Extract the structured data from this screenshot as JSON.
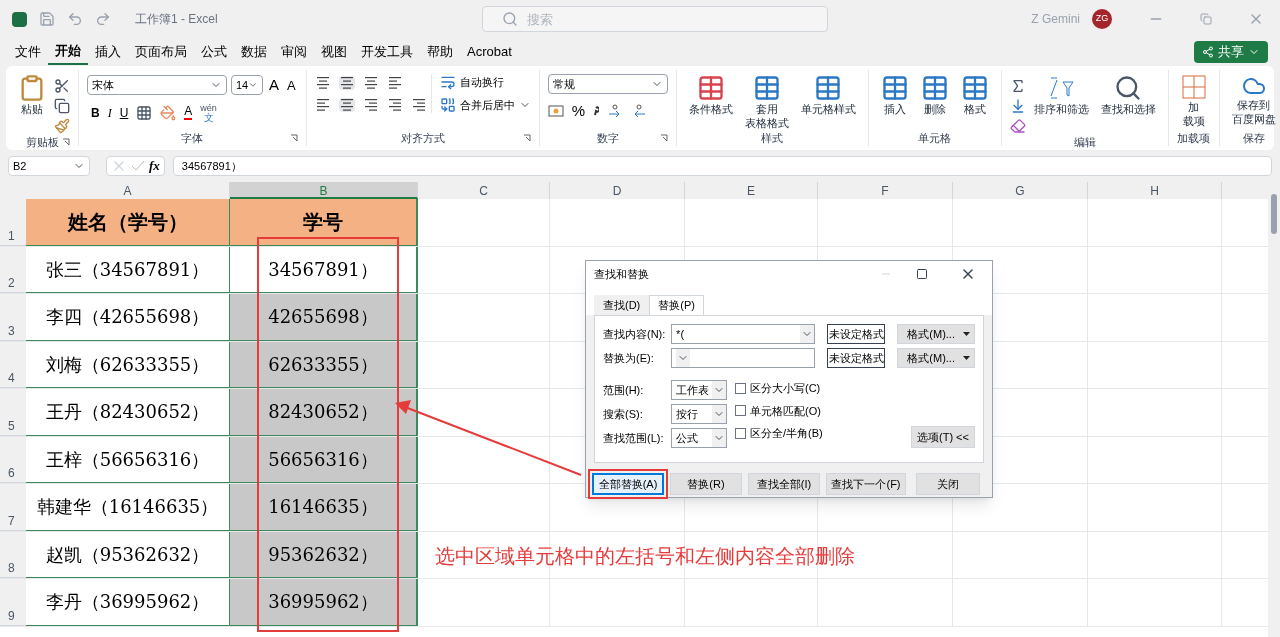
{
  "window": {
    "title": "工作簿1 - Excel",
    "search_placeholder": "搜索",
    "user": "Z Gemini",
    "avatar": "ZG"
  },
  "menu_tabs": [
    {
      "label": "文件",
      "selected": false
    },
    {
      "label": "开始",
      "selected": true
    },
    {
      "label": "插入",
      "selected": false
    },
    {
      "label": "页面布局",
      "selected": false
    },
    {
      "label": "公式",
      "selected": false
    },
    {
      "label": "数据",
      "selected": false
    },
    {
      "label": "审阅",
      "selected": false
    },
    {
      "label": "视图",
      "selected": false
    },
    {
      "label": "开发工具",
      "selected": false
    },
    {
      "label": "帮助",
      "selected": false
    },
    {
      "label": "Acrobat",
      "selected": false
    }
  ],
  "share_button": "共享",
  "ribbon": {
    "clipboard": {
      "label": "剪贴板",
      "paste": "粘贴"
    },
    "font": {
      "label": "字体",
      "font_name": "宋体",
      "font_size": "14",
      "grow": "A",
      "shrink": "A",
      "bold": "B",
      "italic": "I",
      "underline": "U",
      "font_color": "A",
      "phonetic": [
        "wén",
        "文"
      ]
    },
    "alignment": {
      "label": "对齐方式",
      "wrap": "自动换行",
      "merge": "合并后居中"
    },
    "number": {
      "label": "数字",
      "format": "常规",
      "percent": "%"
    },
    "styles": {
      "label": "样式",
      "buttons": [
        [
          "条件格式"
        ],
        [
          "套用",
          "表格格式"
        ],
        [
          "单元格样式"
        ]
      ]
    },
    "cells": {
      "label": "单元格",
      "buttons": [
        [
          "插入"
        ],
        [
          "删除"
        ],
        [
          "格式"
        ]
      ]
    },
    "editing": {
      "label": "编辑",
      "buttons": [
        [
          "排序和筛选"
        ],
        [
          "查找和选择"
        ]
      ]
    },
    "addins": {
      "label": "加载项",
      "button": [
        "加",
        "载项"
      ]
    },
    "save": {
      "label": "保存",
      "button": [
        "保存到",
        "百度网盘"
      ]
    }
  },
  "formula_bar": {
    "name_box": "B2",
    "fx": "fx",
    "content": "34567891）"
  },
  "columns": [
    {
      "label": "A",
      "selected": false
    },
    {
      "label": "B",
      "selected": true
    },
    {
      "label": "C",
      "selected": false
    },
    {
      "label": "D",
      "selected": false
    },
    {
      "label": "E",
      "selected": false
    },
    {
      "label": "F",
      "selected": false
    },
    {
      "label": "G",
      "selected": false
    },
    {
      "label": "H",
      "selected": false
    }
  ],
  "rows": [
    {
      "number": "1",
      "a": "姓名（学号）",
      "b": "学号",
      "header": true,
      "b_selected": false
    },
    {
      "number": "2",
      "a": "张三（34567891）",
      "b": "34567891）",
      "header": false,
      "b_selected": false
    },
    {
      "number": "3",
      "a": "李四（42655698）",
      "b": "42655698）",
      "header": false,
      "b_selected": true
    },
    {
      "number": "4",
      "a": "刘梅（62633355）",
      "b": "62633355）",
      "header": false,
      "b_selected": true
    },
    {
      "number": "5",
      "a": "王丹（82430652）",
      "b": "82430652）",
      "header": false,
      "b_selected": true
    },
    {
      "number": "6",
      "a": "王梓（56656316）",
      "b": "56656316）",
      "header": false,
      "b_selected": true
    },
    {
      "number": "7",
      "a": "韩建华（16146635）",
      "b": "16146635）",
      "header": false,
      "b_selected": true
    },
    {
      "number": "8",
      "a": "赵凯（95362632）",
      "b": "95362632）",
      "header": false,
      "b_selected": true
    },
    {
      "number": "9",
      "a": "李丹（36995962）",
      "b": "36995962）",
      "header": false,
      "b_selected": true
    }
  ],
  "dialog": {
    "title": "查找和替换",
    "tabs": [
      {
        "label": "查找(D)",
        "selected": false
      },
      {
        "label": "替换(P)",
        "selected": true
      }
    ],
    "find": {
      "label": "查找内容(N):",
      "value": "*(",
      "format_state": "未设定格式",
      "format_button": "格式(M)..."
    },
    "replace": {
      "label": "替换为(E):",
      "format_state": "未设定格式",
      "format_button": "格式(M)..."
    },
    "selects": [
      {
        "label": "范围(H):",
        "value": "工作表"
      },
      {
        "label": "搜索(S):",
        "value": "按行"
      },
      {
        "label": "查找范围(L):",
        "value": "公式"
      }
    ],
    "checkboxes": [
      {
        "label": "区分大小写(C)",
        "checked": false
      },
      {
        "label": "单元格匹配(O)",
        "checked": false
      },
      {
        "label": "区分全/半角(B)",
        "checked": false
      }
    ],
    "options_button": "选项(T) <<",
    "buttons": [
      {
        "label": "全部替换(A)",
        "selected": true
      },
      {
        "label": "替换(R)",
        "selected": false
      },
      {
        "label": "查找全部(I)",
        "selected": false
      },
      {
        "label": "查找下一个(F)",
        "selected": false
      },
      {
        "label": "关闭",
        "selected": false
      }
    ]
  },
  "annotation": "选中区域单元格中的左括号和左侧内容全部删除"
}
